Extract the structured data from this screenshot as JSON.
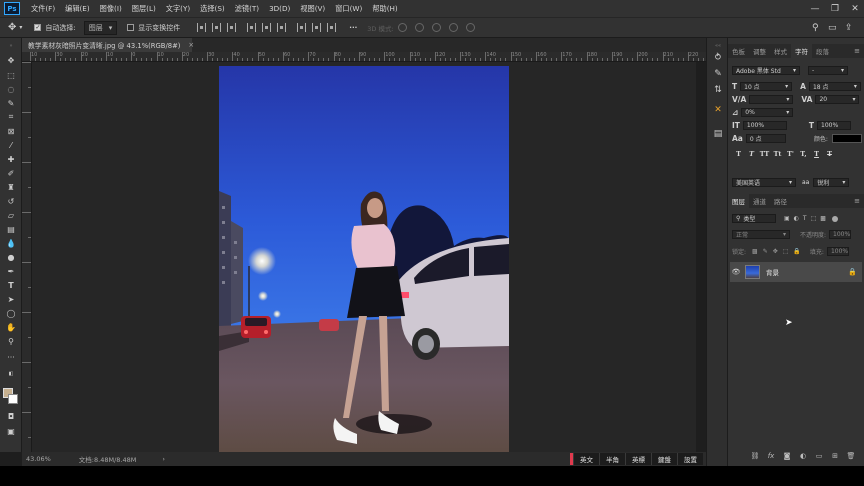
{
  "app": {
    "logo": "Ps"
  },
  "menu": [
    "文件(F)",
    "编辑(E)",
    "图像(I)",
    "图层(L)",
    "文字(Y)",
    "选择(S)",
    "滤镜(T)",
    "3D(D)",
    "视图(V)",
    "窗口(W)",
    "帮助(H)"
  ],
  "window_controls": {
    "minimize": "—",
    "restore": "❐",
    "close": "✕"
  },
  "options": {
    "auto_select_label": "自动选择:",
    "auto_select_value": "图层",
    "show_transform_label": "显示变换控件",
    "mode_3d_label": "3D 模式:",
    "more": "···"
  },
  "document": {
    "tab_title": "教学素材灰暗照片变清晰.jpg @ 43.1%(RGB/8#)",
    "close": "×",
    "zoom": "43.06%",
    "doc_info": "文档:8.48M/8.48M",
    "arrow": "›"
  },
  "ruler": {
    "h_labels": [
      "10",
      "30",
      "20",
      "10",
      "0",
      "10",
      "20",
      "30",
      "40",
      "50",
      "60",
      "70",
      "80",
      "90",
      "100",
      "110",
      "120",
      "130",
      "140",
      "150",
      "160",
      "170",
      "180",
      "190",
      "200",
      "210",
      "220"
    ]
  },
  "ime": [
    "英文",
    "半角",
    "英標",
    "鍵盤",
    "設置"
  ],
  "panels": {
    "top_tabs": [
      "色板",
      "调整",
      "样式",
      "字符",
      "段落"
    ],
    "active_top_tab": "字符",
    "character": {
      "font_family": "Adobe 黑体 Std",
      "font_style": "-",
      "font_size": "10 点",
      "leading": "18 点",
      "kerning": "",
      "tracking": "20",
      "tsume": "0%",
      "vertical_scale": "100%",
      "horizontal_scale": "100%",
      "baseline_shift": "0 点",
      "color_label": "颜色:",
      "color_value": "#000000",
      "language": "美国英语",
      "aa_label": "aa",
      "antialias": "锐利",
      "tt_buttons": [
        "T",
        "T",
        "TT",
        "Tt",
        "T'",
        "T,",
        "T",
        "T"
      ]
    },
    "layers": {
      "tabs": [
        "图层",
        "通道",
        "路径"
      ],
      "active_tab": "图层",
      "filter_kind": "类型",
      "blend_mode": "正常",
      "opacity_label": "不透明度:",
      "opacity_value": "100%",
      "lock_label": "锁定:",
      "fill_label": "填充:",
      "fill_value": "100%",
      "items": [
        {
          "name": "背景",
          "visible": true,
          "locked": true
        }
      ]
    }
  },
  "icons": {
    "eye": "👁",
    "lock": "🔒"
  }
}
